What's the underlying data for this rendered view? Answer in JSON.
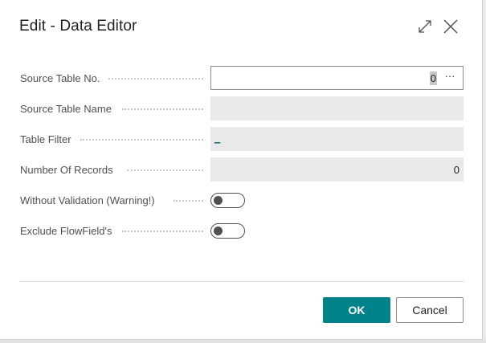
{
  "dialog": {
    "title": "Edit - Data Editor",
    "expand_icon": "expand-arrows-icon",
    "close_icon": "close-x-icon"
  },
  "fields": {
    "source_table_no": {
      "label": "Source Table No.",
      "value": "0",
      "assist": "···"
    },
    "source_table_name": {
      "label": "Source Table Name",
      "value": ""
    },
    "table_filter": {
      "label": "Table Filter",
      "value": "_"
    },
    "number_of_records": {
      "label": "Number Of Records",
      "value": "0"
    },
    "without_validation": {
      "label": "Without Validation (Warning!)",
      "checked": false
    },
    "exclude_flowfields": {
      "label": "Exclude FlowField's",
      "checked": false
    }
  },
  "footer": {
    "ok_label": "OK",
    "cancel_label": "Cancel"
  },
  "colors": {
    "accent": "#00828a",
    "link": "#0b6a7a",
    "readonly_field": "#e9e9e9"
  }
}
